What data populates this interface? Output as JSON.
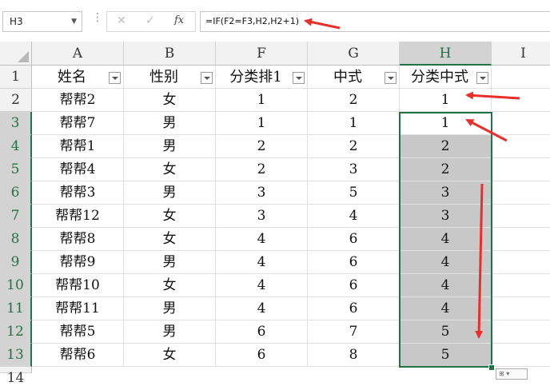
{
  "name_box": "H3",
  "formula": "=IF(F2=F3,H2,H2+1)",
  "icons": {
    "cancel": "✕",
    "enter": "✓",
    "function": "fx"
  },
  "columns": [
    "A",
    "B",
    "F",
    "G",
    "H",
    "I"
  ],
  "row_numbers": [
    "1",
    "2",
    "3",
    "4",
    "5",
    "6",
    "7",
    "8",
    "9",
    "10",
    "11",
    "12",
    "13",
    "14"
  ],
  "headers": [
    "姓名",
    "性别",
    "分类排1",
    "中式",
    "分类中式"
  ],
  "rows": [
    [
      "帮帮2",
      "女",
      "1",
      "2",
      "1"
    ],
    [
      "帮帮7",
      "男",
      "1",
      "1",
      "1"
    ],
    [
      "帮帮1",
      "男",
      "2",
      "2",
      "2"
    ],
    [
      "帮帮4",
      "女",
      "2",
      "3",
      "2"
    ],
    [
      "帮帮3",
      "男",
      "3",
      "5",
      "3"
    ],
    [
      "帮帮12",
      "女",
      "3",
      "4",
      "3"
    ],
    [
      "帮帮8",
      "女",
      "4",
      "6",
      "4"
    ],
    [
      "帮帮9",
      "男",
      "4",
      "6",
      "4"
    ],
    [
      "帮帮10",
      "女",
      "4",
      "6",
      "4"
    ],
    [
      "帮帮11",
      "男",
      "4",
      "6",
      "4"
    ],
    [
      "帮帮5",
      "男",
      "6",
      "7",
      "5"
    ],
    [
      "帮帮6",
      "女",
      "6",
      "8",
      "5"
    ]
  ],
  "colors": {
    "selection": "#217346",
    "highlight": "#c8c8c8",
    "arrow": "#e8302a"
  }
}
